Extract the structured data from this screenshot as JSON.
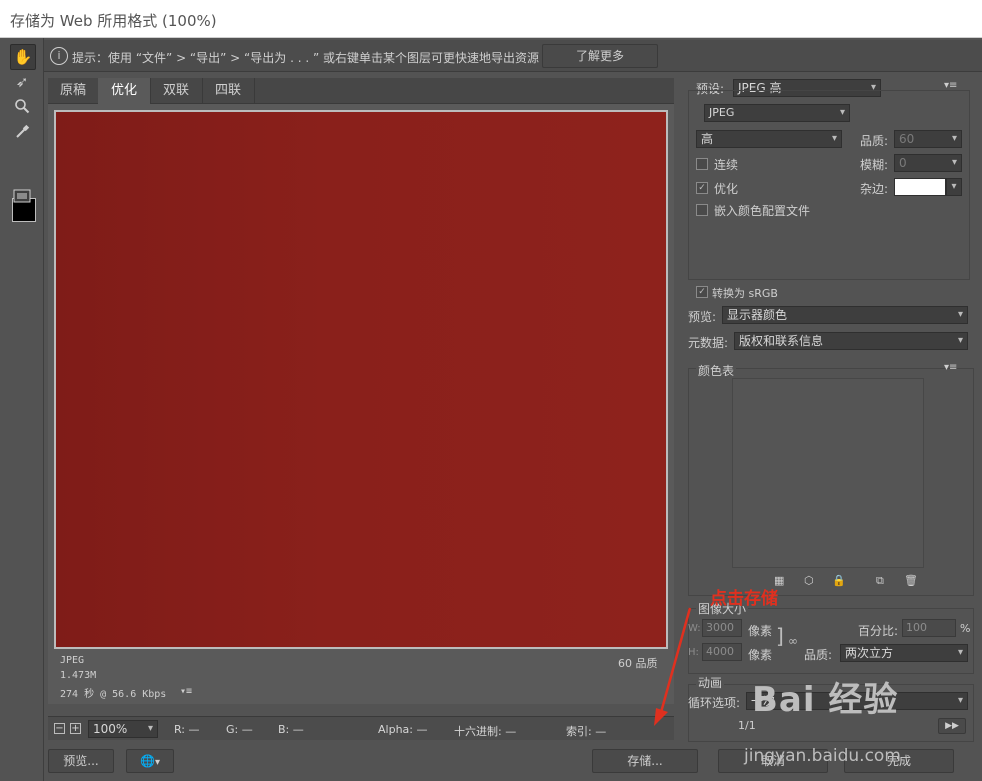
{
  "window": {
    "title": "存储为 Web 所用格式 (100%)"
  },
  "tools": {
    "icons": [
      "hand-icon",
      "slice-select-icon",
      "zoom-icon",
      "eyedropper-icon",
      "eyedropper-color-icon",
      "toggle-slices-icon"
    ]
  },
  "infobar": {
    "icon": "info-icon",
    "message": "提示：使用 “文件” > “导出” > “导出为 . . . ” 或右键单击某个图层可更快速地导出资源",
    "learn_more": "了解更多"
  },
  "tabs": [
    "原稿",
    "优化",
    "双联",
    "四联"
  ],
  "active_tab": "优化",
  "preview": {
    "format": "JPEG",
    "size": "1.473M",
    "time": "274 秒 @ 56.6 Kbps",
    "quality": "60 品质",
    "image_color": "#8a201b"
  },
  "statusbar": {
    "zoom": "100%",
    "r": "R: —",
    "g": "G: —",
    "b": "B: —",
    "alpha": "Alpha: —",
    "hex": "十六进制: —",
    "index": "索引: —"
  },
  "bottombar": {
    "preview": "预览...",
    "save": "存储...",
    "cancel": "取消",
    "done": "完成"
  },
  "settings": {
    "preset_label": "预设:",
    "preset_value": "JPEG 高",
    "format": "JPEG",
    "quality_level": "高",
    "quality_label": "品质:",
    "quality_value": "60",
    "progressive_label": "连续",
    "blur_label": "模糊:",
    "blur_value": "0",
    "optimized_label": "优化",
    "matte_label": "杂边:",
    "embed_profile_label": "嵌入颜色配置文件",
    "convert_srgb_label": "转换为 sRGB",
    "preview_label": "预览:",
    "preview_value": "显示器颜色",
    "metadata_label": "元数据:",
    "metadata_value": "版权和联系信息"
  },
  "color_table": {
    "title": "颜色表"
  },
  "image_size": {
    "title": "图像大小",
    "w_label": "W:",
    "w_value": "3000",
    "h_label": "H:",
    "h_value": "4000",
    "unit": "像素",
    "percent_label": "百分比:",
    "percent_value": "100",
    "percent_unit": "%",
    "quality_label": "品质:",
    "quality_value": "两次立方"
  },
  "animation": {
    "title": "动画",
    "loop_label": "循环选项:",
    "loop_value": "一次",
    "frame_counter": "1/1"
  },
  "annotation": {
    "text": "点击存储",
    "color": "#e0301f"
  },
  "watermark": {
    "brand": "Bai 经验",
    "url": "jingyan.baidu.com"
  }
}
